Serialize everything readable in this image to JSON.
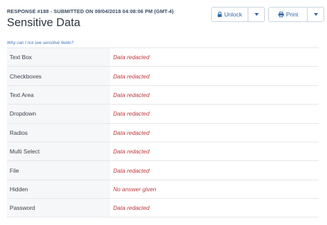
{
  "response": {
    "meta_line": "RESPONSE #188 - SUBMITTED ON 09/04/2018 04:08:06 PM (GMT-4)",
    "title": "Sensitive Data"
  },
  "actions": {
    "unlock_label": "Unlock",
    "print_label": "Print"
  },
  "help_link": "Why can I not see sensitive fields?",
  "fields": [
    {
      "label": "Text Box",
      "value": "Data redacted"
    },
    {
      "label": "Checkboxes",
      "value": "Data redacted"
    },
    {
      "label": "Text Area",
      "value": "Data redacted"
    },
    {
      "label": "Dropdown",
      "value": "Data redacted"
    },
    {
      "label": "Radios",
      "value": "Data redacted"
    },
    {
      "label": "Multi Select",
      "value": "Data redacted"
    },
    {
      "label": "File",
      "value": "Data redacted"
    },
    {
      "label": "Hidden",
      "value": "No answer given"
    },
    {
      "label": "Password",
      "value": "Data redacted"
    }
  ],
  "colors": {
    "accent": "#2f65a7",
    "redacted_text": "#c0383a",
    "label_background": "#f6f7f9"
  },
  "icons": {
    "unlock": "lock-icon",
    "print": "printer-icon",
    "dropdown": "chevron-down-icon"
  }
}
